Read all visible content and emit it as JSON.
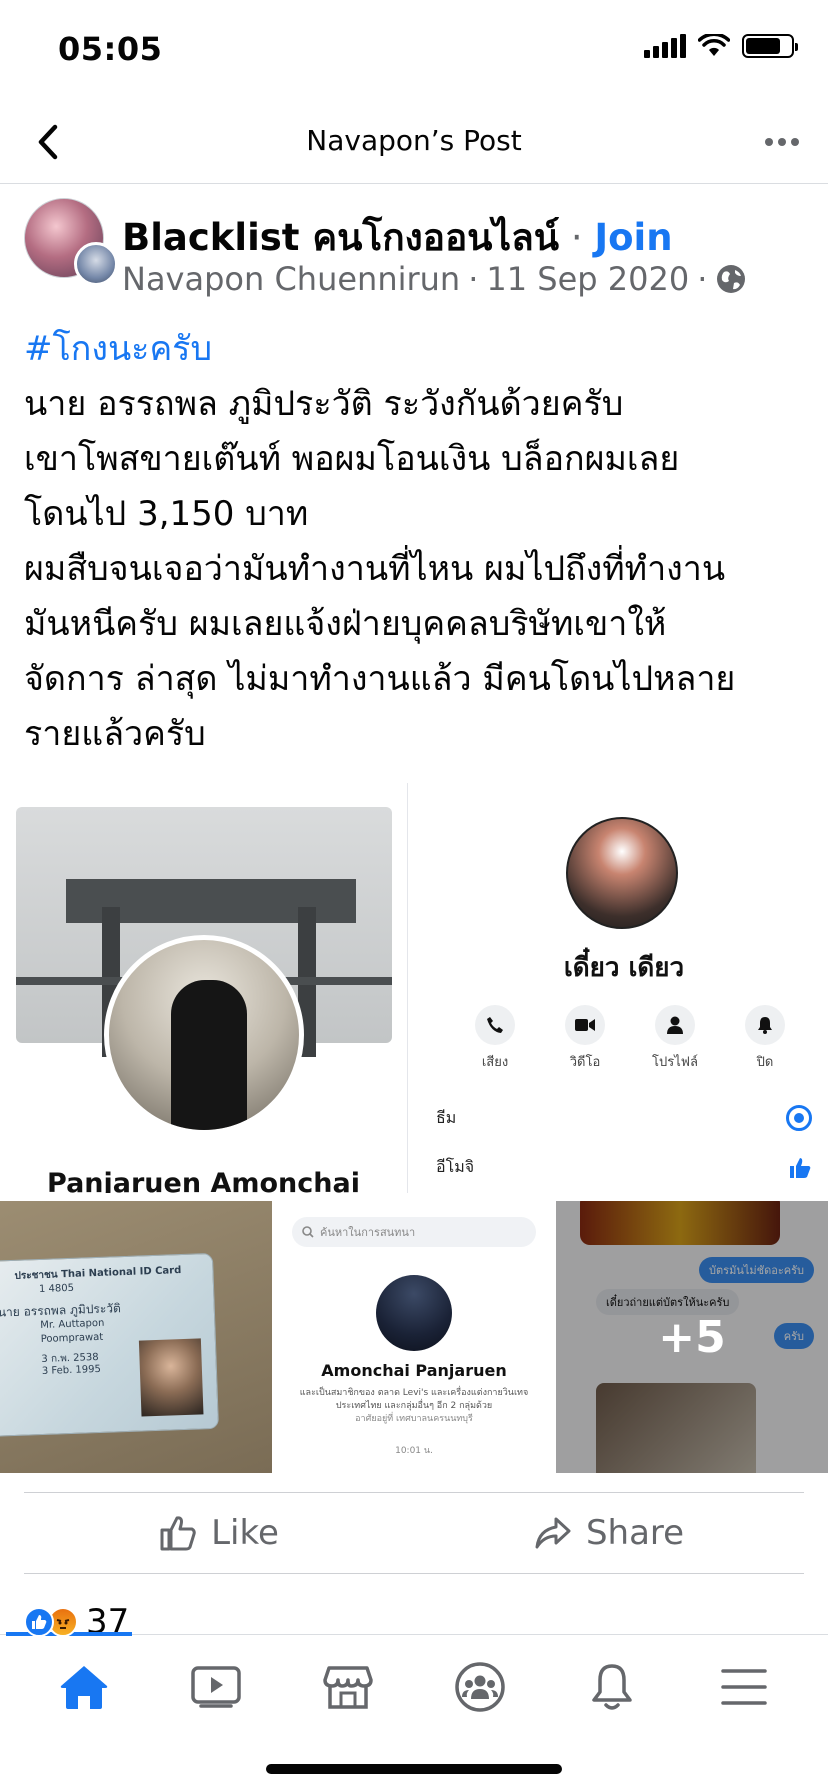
{
  "status": {
    "time": "05:05"
  },
  "nav": {
    "title": "Navapon’s Post"
  },
  "post": {
    "group_name": "Blacklist คนโกงออนไลน์",
    "separator": "·",
    "join_label": "Join",
    "author": "Navapon Chuennirun",
    "date": "11 Sep 2020",
    "hashtag": "#โกงนะครับ",
    "body_lines": [
      "นาย อรรถพล ภูมิประวัติ ระวังกันด้วยครับ",
      "เขาโพสขายเต๊นท์ พอผมโอนเงิน บล็อกผมเลย",
      "โดนไป 3,150 บาท",
      "ผมสืบจนเจอว่ามันทำงานที่ไหน ผมไปถึงที่ทำงาน",
      "มันหนีครับ ผมเลยแจ้งฝ่ายบุคคลบริษัทเขาให้",
      "จัดการ ล่าสุด ไม่มาทำงานแล้ว มีคนโดนไปหลาย",
      "รายแล้วครับ"
    ]
  },
  "photos": {
    "p1_name": "Panjaruen Amonchai",
    "p2_name": "เดี๋ยว เดียว",
    "p2_actions": [
      "เสียง",
      "วิดีโอ",
      "โปรไฟล์",
      "ปิด"
    ],
    "p2_theme_label": "ธีม",
    "p2_emoji_label": "อีโมจิ",
    "p3_card_lines": [
      "ประชาชน Thai National ID Card",
      "1 4805",
      "นาย อรรถพล ภูมิประวัติ",
      "Mr. Auttapon",
      "Poomprawat",
      "3 ก.พ. 2538",
      "3 Feb. 1995"
    ],
    "p4_search": "ค้นหาในการสนทนา",
    "p4_name": "Amonchai Panjaruen",
    "p4_desc": "และเป็นสมาชิกของ ตลาด Levi's และเครื่องแต่งกายวินเทจประเทศไทย และกลุ่มอื่นๆ อีก 2 กลุ่มด้วย",
    "p4_location": "อาศัยอยู่ที่ เทศบาลนครนนทบุรี",
    "p4_time": "10:01 น.",
    "p5_bubble1": "บัตรมันไม่ชัดอะครับ",
    "p5_bubble2": "เดี๋ยวถ่ายแต่บัตรให้นะครับ",
    "p5_bubble3": "ครับ",
    "more_count": "+5"
  },
  "actions": {
    "like_label": "Like",
    "share_label": "Share"
  },
  "reactions": {
    "count": "37"
  },
  "colors": {
    "accent": "#1877f2",
    "secondary_text": "#65676b",
    "divider": "#ced0d4"
  },
  "icons": {
    "back": "chevron-left-icon",
    "more": "more-horizontal-icon",
    "globe": "globe-icon",
    "like": "thumbs-up-icon",
    "share": "share-arrow-icon",
    "tabs": [
      "home-icon",
      "video-icon",
      "marketplace-icon",
      "groups-icon",
      "bell-icon",
      "menu-icon"
    ]
  }
}
